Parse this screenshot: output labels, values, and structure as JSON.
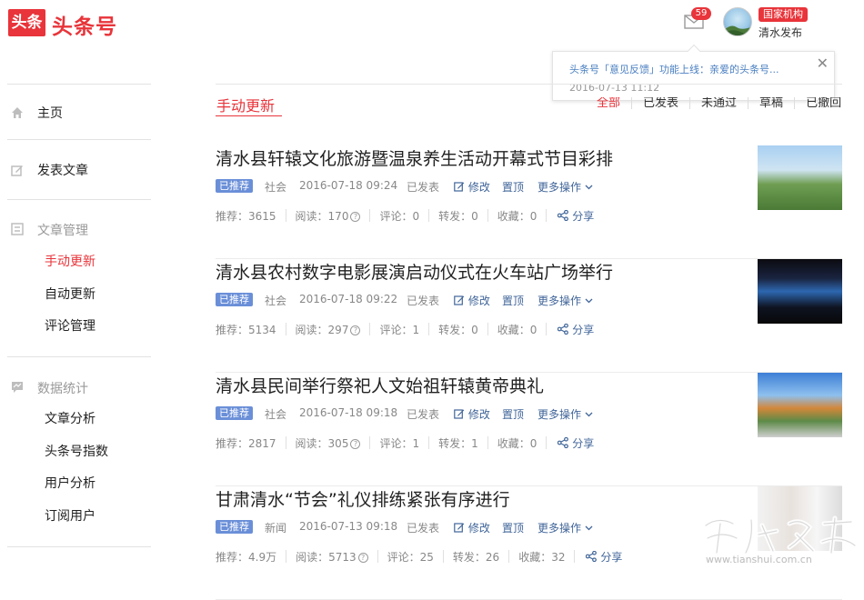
{
  "header": {
    "logo_box": "头条",
    "logo_text": "头条号",
    "mail_count": "59",
    "account_badge": "国家机构",
    "account_name": "清水发布"
  },
  "notification": {
    "message": "头条号「意见反馈」功能上线：亲爱的头条号...",
    "time": "2016-07-13 11:12"
  },
  "sidebar": {
    "home": "主页",
    "publish": "发表文章",
    "article_mgmt": "文章管理",
    "article_items": [
      "手动更新",
      "自动更新",
      "评论管理"
    ],
    "stats": "数据统计",
    "stats_items": [
      "文章分析",
      "头条号指数",
      "用户分析",
      "订阅用户"
    ]
  },
  "main": {
    "tab": "手动更新",
    "filters": [
      "全部",
      "已发表",
      "未通过",
      "草稿",
      "已撤回"
    ]
  },
  "labels": {
    "edit": "修改",
    "pin": "置顶",
    "more": "更多操作",
    "share": "分享",
    "rec": "推荐：",
    "read": "阅读：",
    "comment": "评论：",
    "forward": "转发：",
    "fav": "收藏："
  },
  "articles": [
    {
      "title": "清水县轩辕文化旅游暨温泉养生活动开幕式节目彩排",
      "tag": "已推荐",
      "category": "社会",
      "date": "2016-07-18 09:24",
      "status": "已发表",
      "rec": "3615",
      "read": "170",
      "comment": "0",
      "forward": "0",
      "fav": "0"
    },
    {
      "title": "清水县农村数字电影展演启动仪式在火车站广场举行",
      "tag": "已推荐",
      "category": "社会",
      "date": "2016-07-18 09:22",
      "status": "已发表",
      "rec": "5134",
      "read": "297",
      "comment": "1",
      "forward": "0",
      "fav": "0"
    },
    {
      "title": "清水县民间举行祭祀人文始祖轩辕黄帝典礼",
      "tag": "已推荐",
      "category": "社会",
      "date": "2016-07-18 09:18",
      "status": "已发表",
      "rec": "2817",
      "read": "305",
      "comment": "1",
      "forward": "1",
      "fav": "0"
    },
    {
      "title": "甘肃清水“节会”礼仪排练紧张有序进行",
      "tag": "已推荐",
      "category": "新闻",
      "date": "2016-07-13 09:18",
      "status": "已发表",
      "rec": "4.9万",
      "read": "5713",
      "comment": "25",
      "forward": "26",
      "fav": "32"
    }
  ],
  "watermark": "www.tianshui.com.cn"
}
